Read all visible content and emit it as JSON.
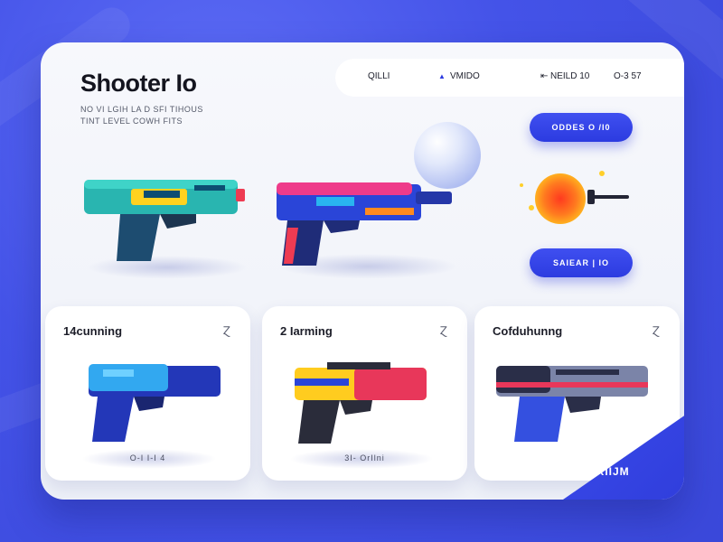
{
  "app": {
    "title": "Shooter Io",
    "subtitle_lines": [
      "NO VI LGIH LA D SFI TIHOUS",
      "TINT LEVEL COWH FITS"
    ]
  },
  "topbar": {
    "item1": "QILLI",
    "item2_icon": "triangle-icon",
    "item2": "VMIDO",
    "item3_icon": "arrow-icon",
    "item3": "NEILD 10",
    "item4": "O-3 57"
  },
  "actions": {
    "top_button": "ODDES O /I0",
    "bottom_button": "SAIEAR | IO"
  },
  "cards": [
    {
      "title": "14cunning",
      "footer": "O-I I-I 4",
      "gun_colors": [
        "#32a8f0",
        "#2337b8"
      ]
    },
    {
      "title": "2 Iarming",
      "footer": "3I- OrIlni",
      "gun_colors": [
        "#ffcc1f",
        "#e8375a"
      ]
    },
    {
      "title": "Cofduhunng",
      "footer": "",
      "gun_colors": [
        "#7b84a8",
        "#3450e0"
      ]
    }
  ],
  "corner_label": "IORIIJM",
  "colors": {
    "background": "#4453e8",
    "accent": "#2c3be0",
    "panel": "#f4f6fb"
  }
}
